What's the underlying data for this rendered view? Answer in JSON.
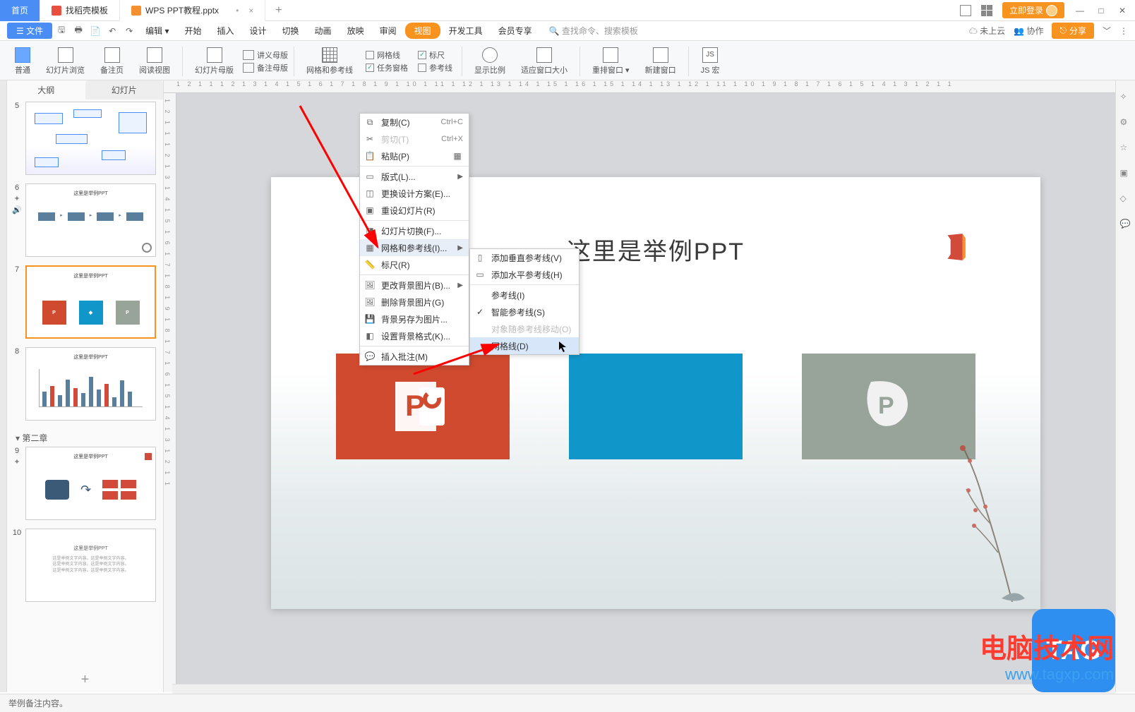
{
  "titlebar": {
    "home": "首页",
    "template": "找稻壳模板",
    "file": "WPS PPT教程.pptx",
    "login": "立即登录",
    "add": "+",
    "mod_dot": "•"
  },
  "menubar": {
    "file": "文件",
    "edit": "编辑",
    "tabs": [
      "开始",
      "插入",
      "设计",
      "切换",
      "动画",
      "放映",
      "审阅",
      "视图",
      "开发工具",
      "会员专享"
    ],
    "active_index": 7,
    "search_placeholder": "查找命令、搜索模板",
    "search_prefix": "Q",
    "notcloud": "未上云",
    "coop": "协作",
    "share": "分享"
  },
  "ribbon": {
    "r1": "普通",
    "r2": "幻灯片浏览",
    "r3": "备注页",
    "r4": "阅读视图",
    "r5": "幻灯片母版",
    "r6": "讲义母版",
    "r7": "备注母版",
    "r8": "网格和参考线",
    "c1": "网格线",
    "c2": "任务窗格",
    "c3": "标尺",
    "c4": "参考线",
    "r9": "显示比例",
    "r10": "适应窗口大小",
    "r11": "重排窗口",
    "r12": "新建窗口",
    "r13": "JS 宏"
  },
  "sidepanel": {
    "tab_outline": "大纲",
    "tab_slides": "幻灯片",
    "nums": [
      "5",
      "6",
      "7",
      "8",
      "9",
      "10"
    ],
    "section": "第二章",
    "thumb_title": "这里是举例PPT",
    "add": "+"
  },
  "slide": {
    "title": "这里是举例PPT"
  },
  "ctx1": {
    "copy": "复制(C)",
    "copy_sc": "Ctrl+C",
    "cut": "剪切(T)",
    "cut_sc": "Ctrl+X",
    "paste": "粘贴(P)",
    "layout": "版式(L)...",
    "scheme": "更换设计方案(E)...",
    "reset": "重设幻灯片(R)",
    "trans": "幻灯片切换(F)...",
    "gridguide": "网格和参考线(I)...",
    "ruler": "标尺(R)",
    "changebg": "更改背景图片(B)...",
    "delbg": "删除背景图片(G)",
    "savebg": "背景另存为图片...",
    "bgformat": "设置背景格式(K)...",
    "comment": "插入批注(M)"
  },
  "ctx2": {
    "addv": "添加垂直参考线(V)",
    "addh": "添加水平参考线(H)",
    "guide": "参考线(I)",
    "smart": "智能参考线(S)",
    "follow": "对象随参考线移动(O)",
    "gridline": "网格线(D)"
  },
  "ruler_h": "1  2  1  1  1  2  1  3  1  4  1  5  1  6  1  7  1  8  1  9  1  10  1  11  1  12  1  13  1  14  1  15  1  16  1  15  1  14  1  13  1  12  1  11  1  10  1  9  1  8  1  7  1  6  1  5  1  4  1  3  1  2  1  1",
  "ruler_v": "1 2 1 1 1 2 1 3 1 4 1 5 1 6 1 7 1 8 1 9 1 8 1 7 1 6 1 5 1 4 1 3 1 2 1 1",
  "status": {
    "note": "举例备注内容。"
  },
  "watermark": {
    "line1": "电脑技术网",
    "line2": "www.tagxp.com",
    "tag": "TAG"
  }
}
